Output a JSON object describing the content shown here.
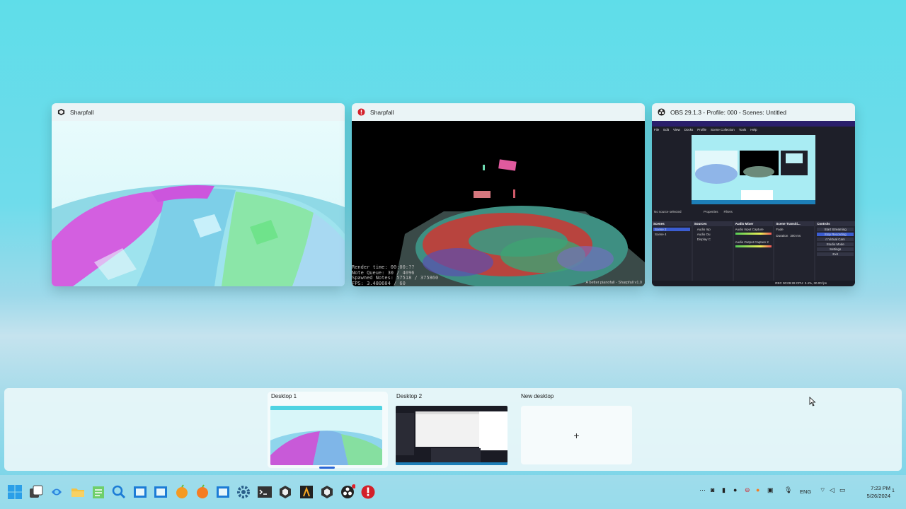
{
  "windows": [
    {
      "title": "Sharpfall",
      "icon": "unity-icon"
    },
    {
      "title": "Sharpfall",
      "icon": "error-icon",
      "overlay_lines": [
        "Render time: 00:00:??",
        "Note Queue: 30 / 4096",
        "Spawned Notes: 57518 / 375860",
        "FPS: 3.480604 / 60"
      ],
      "credit": "A better pianofall - Sharpfall v1.0"
    },
    {
      "title": "OBS 29.1.3 - Profile: 000 - Scenes: Untitled",
      "icon": "obs-icon",
      "menu": [
        "File",
        "Edit",
        "View",
        "Docks",
        "Profile",
        "Scene Collection",
        "Tools",
        "Help"
      ],
      "no_source": "No source selected",
      "props": [
        "Properties",
        "Filters"
      ],
      "docks": [
        {
          "title": "Scenes",
          "items": [
            "Scene 2",
            "Scene 4"
          ]
        },
        {
          "title": "Sources",
          "items": [
            "Audio Inp",
            "Audio Ou",
            "Display C"
          ]
        },
        {
          "title": "Audio Mixer",
          "items": [
            "Audio Input Capture",
            "Audio Output Capture 2"
          ]
        },
        {
          "title": "Scene Transiti...",
          "items": [
            "Fade",
            "Duration",
            "300 ms"
          ]
        },
        {
          "title": "Controls",
          "items": [
            "Start Streaming",
            "Stop Recording",
            "rt Virtual Cam",
            "Studio Mode",
            "Settings",
            "Exit"
          ]
        }
      ],
      "status": "REC 00:09:28  CPU: 3.4%, 30.00 fps"
    }
  ],
  "desktops": [
    {
      "label": "Desktop 1",
      "active": true
    },
    {
      "label": "Desktop 2",
      "active": false
    }
  ],
  "new_desktop": {
    "label": "New desktop",
    "plus": "+"
  },
  "tray": {
    "lang": "ENG",
    "time": "7:23 PM",
    "date": "5/26/2024",
    "notif": "1"
  },
  "colors": {
    "accent": "#2b66d6"
  }
}
